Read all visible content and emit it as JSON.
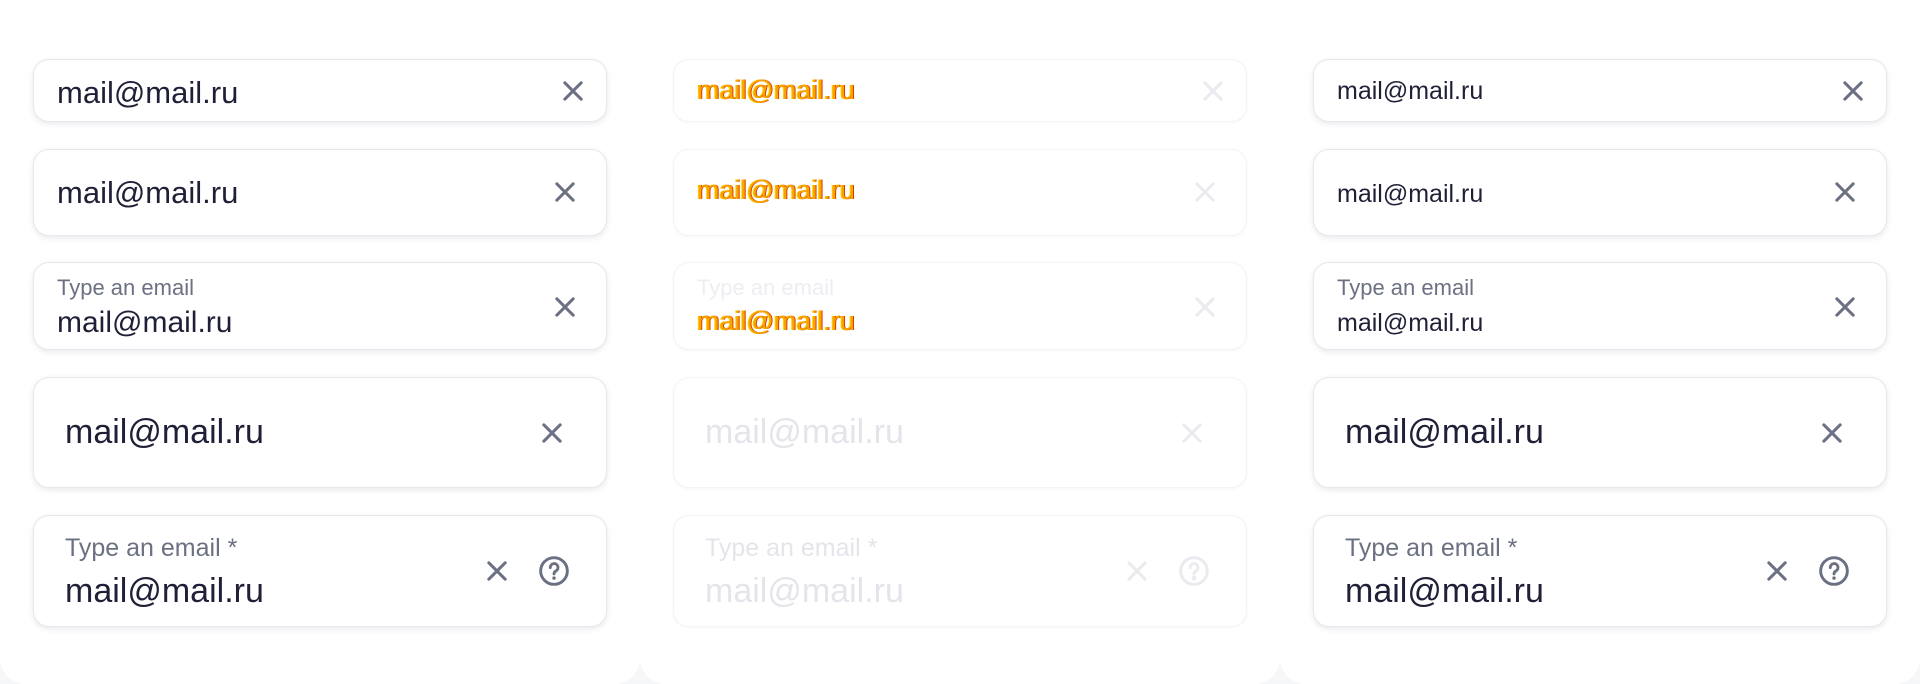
{
  "email_value": "mail@mail.ru",
  "label": "Type an email",
  "label_required": "Type an email *",
  "icons": {
    "clear": "close-icon",
    "help": "question-circle-icon"
  },
  "colors": {
    "text": "#1f2037",
    "label": "#6b7082",
    "icon": "#6b7082",
    "disabled_text": "#e4e5ea",
    "border": "#e6e8ee",
    "background": "#f6f7f9"
  },
  "columns": [
    {
      "state": "default"
    },
    {
      "state": "disabled"
    },
    {
      "state": "compact"
    }
  ]
}
